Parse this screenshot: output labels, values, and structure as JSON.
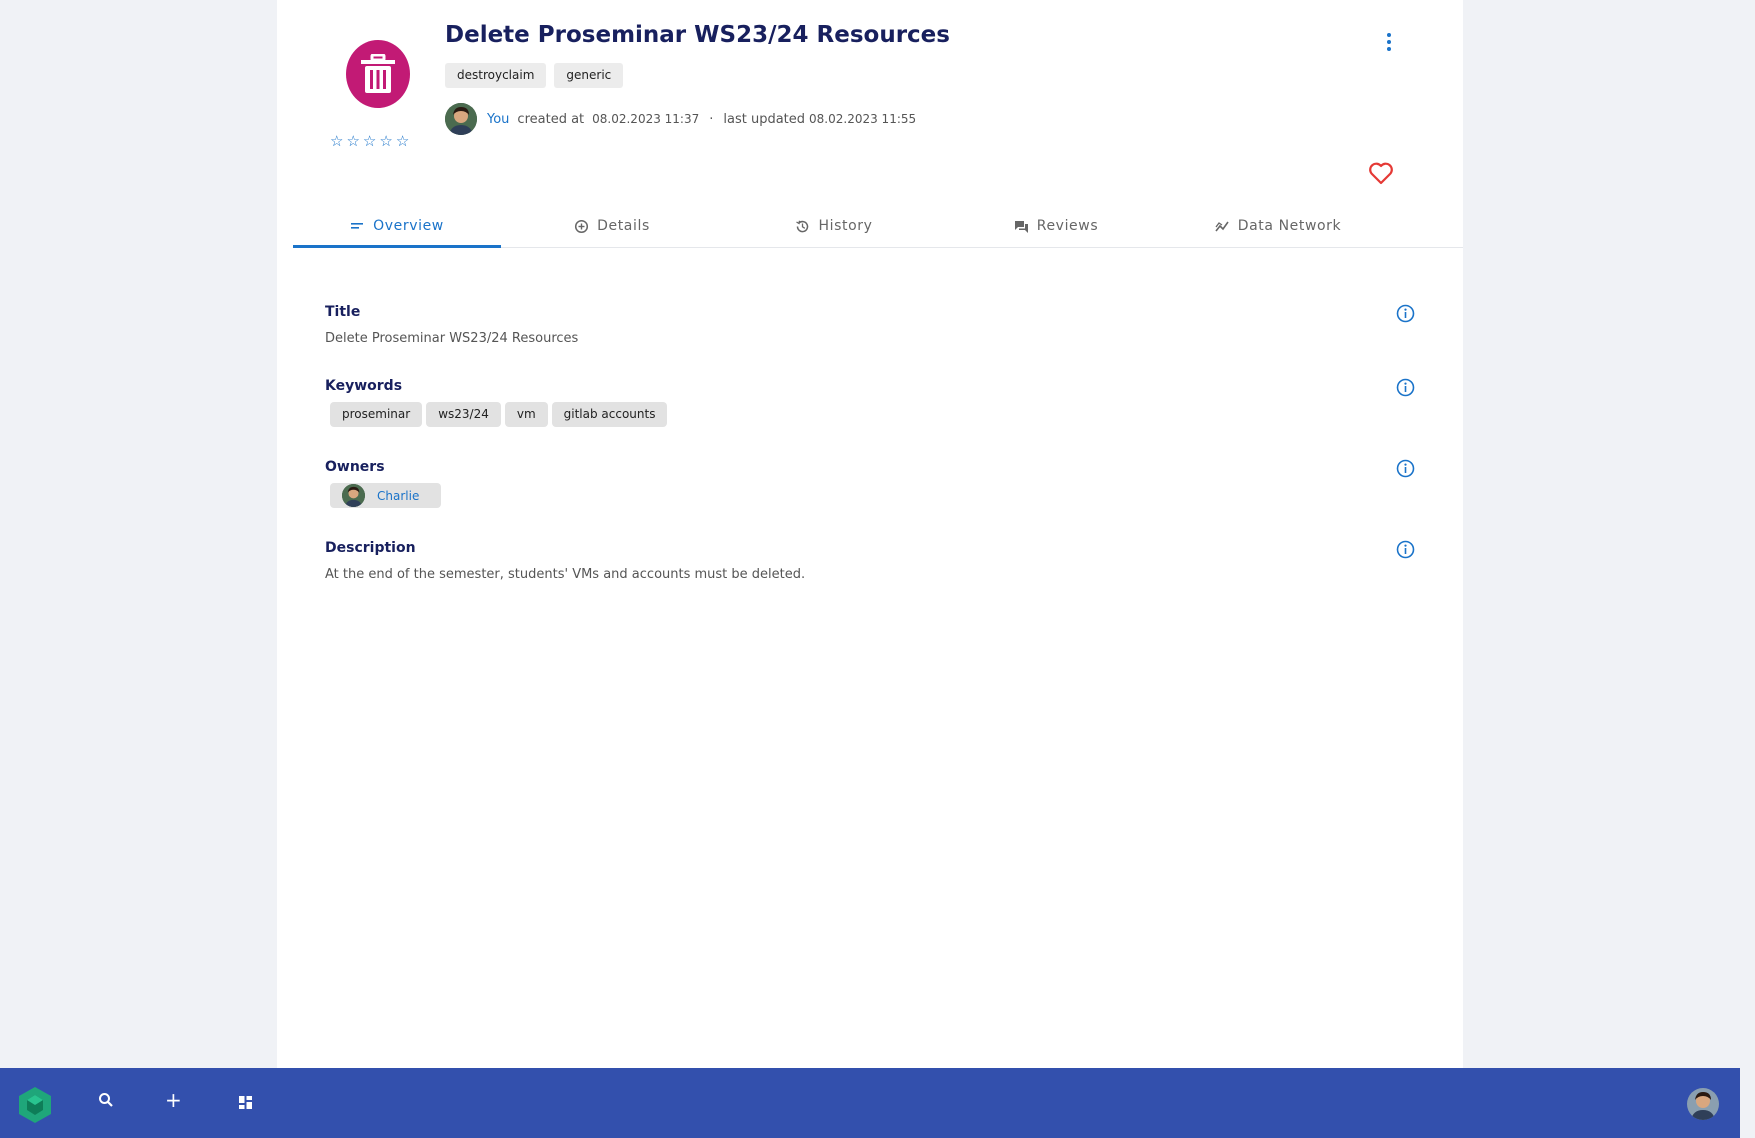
{
  "resource": {
    "title": "Delete Proseminar WS23/24 Resources",
    "icon": "trash-icon",
    "icon_color": "#c21a75",
    "types": [
      "destroyclaim",
      "generic"
    ],
    "rating": {
      "value": 0,
      "max": 5
    },
    "meta": {
      "author": "You",
      "created_label": "created at",
      "created_at": "08.02.2023 11:37",
      "separator": "·",
      "updated_label": "last updated",
      "updated_at": "08.02.2023 11:55"
    }
  },
  "tabs": [
    {
      "label": "Overview",
      "icon": "overview-icon",
      "active": true
    },
    {
      "label": "Details",
      "icon": "details-icon",
      "active": false
    },
    {
      "label": "History",
      "icon": "history-icon",
      "active": false
    },
    {
      "label": "Reviews",
      "icon": "reviews-icon",
      "active": false
    },
    {
      "label": "Data Network",
      "icon": "data-network-icon",
      "active": false
    }
  ],
  "overview": {
    "title_label": "Title",
    "title_value": "Delete Proseminar WS23/24 Resources",
    "keywords_label": "Keywords",
    "keywords": [
      "proseminar",
      "ws23/24",
      "vm",
      "gitlab accounts"
    ],
    "owners_label": "Owners",
    "owners": [
      "Charlie"
    ],
    "description_label": "Description",
    "description_value": "At the end of the semester, students' VMs and accounts must be deleted."
  },
  "bottombar": {
    "color": "#3350ad",
    "add_label": "+"
  },
  "colors": {
    "accent": "#1a73c9",
    "heading": "#18205e",
    "favorite": "#e53935"
  }
}
